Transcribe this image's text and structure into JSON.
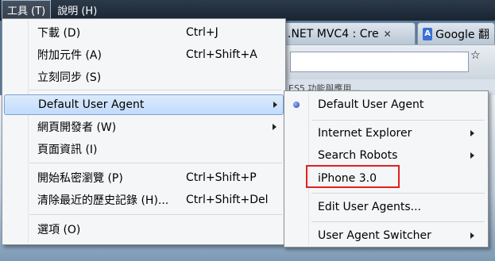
{
  "menubar": {
    "items": [
      {
        "label": "工具 (T)"
      },
      {
        "label": "說明 (H)"
      }
    ]
  },
  "browser": {
    "tabs": [
      {
        "label": ".NET MVC4 : Cre"
      },
      {
        "label": "Google 翻"
      }
    ],
    "close_glyph": "✕",
    "star_glyph": "☆",
    "bookmark_text": "ES5 功能與應用…"
  },
  "main_menu": {
    "items": [
      {
        "label": "下載 (D)",
        "shortcut": "Ctrl+J"
      },
      {
        "label": "附加元件 (A)",
        "shortcut": "Ctrl+Shift+A"
      },
      {
        "label": "立刻同步 (S)",
        "shortcut": ""
      },
      {
        "label": "Default User Agent",
        "shortcut": ""
      },
      {
        "label": "網頁開發者 (W)",
        "shortcut": ""
      },
      {
        "label": "頁面資訊 (I)",
        "shortcut": ""
      },
      {
        "label": "開始私密瀏覽 (P)",
        "shortcut": "Ctrl+Shift+P"
      },
      {
        "label": "清除最近的歷史記錄 (H)...",
        "shortcut": "Ctrl+Shift+Del"
      },
      {
        "label": "選項 (O)",
        "shortcut": ""
      }
    ]
  },
  "sub_menu": {
    "items": [
      {
        "label": "Default User Agent"
      },
      {
        "label": "Internet Explorer"
      },
      {
        "label": "Search Robots"
      },
      {
        "label": "iPhone 3.0"
      },
      {
        "label": "Edit User Agents..."
      },
      {
        "label": "User Agent Switcher"
      }
    ]
  },
  "colors": {
    "highlight_border": "#7da2ce",
    "annotation_red": "#e02020"
  },
  "icons": {
    "radio": "radio-selected-icon",
    "submenu_arrow": "chevron-right-icon"
  }
}
